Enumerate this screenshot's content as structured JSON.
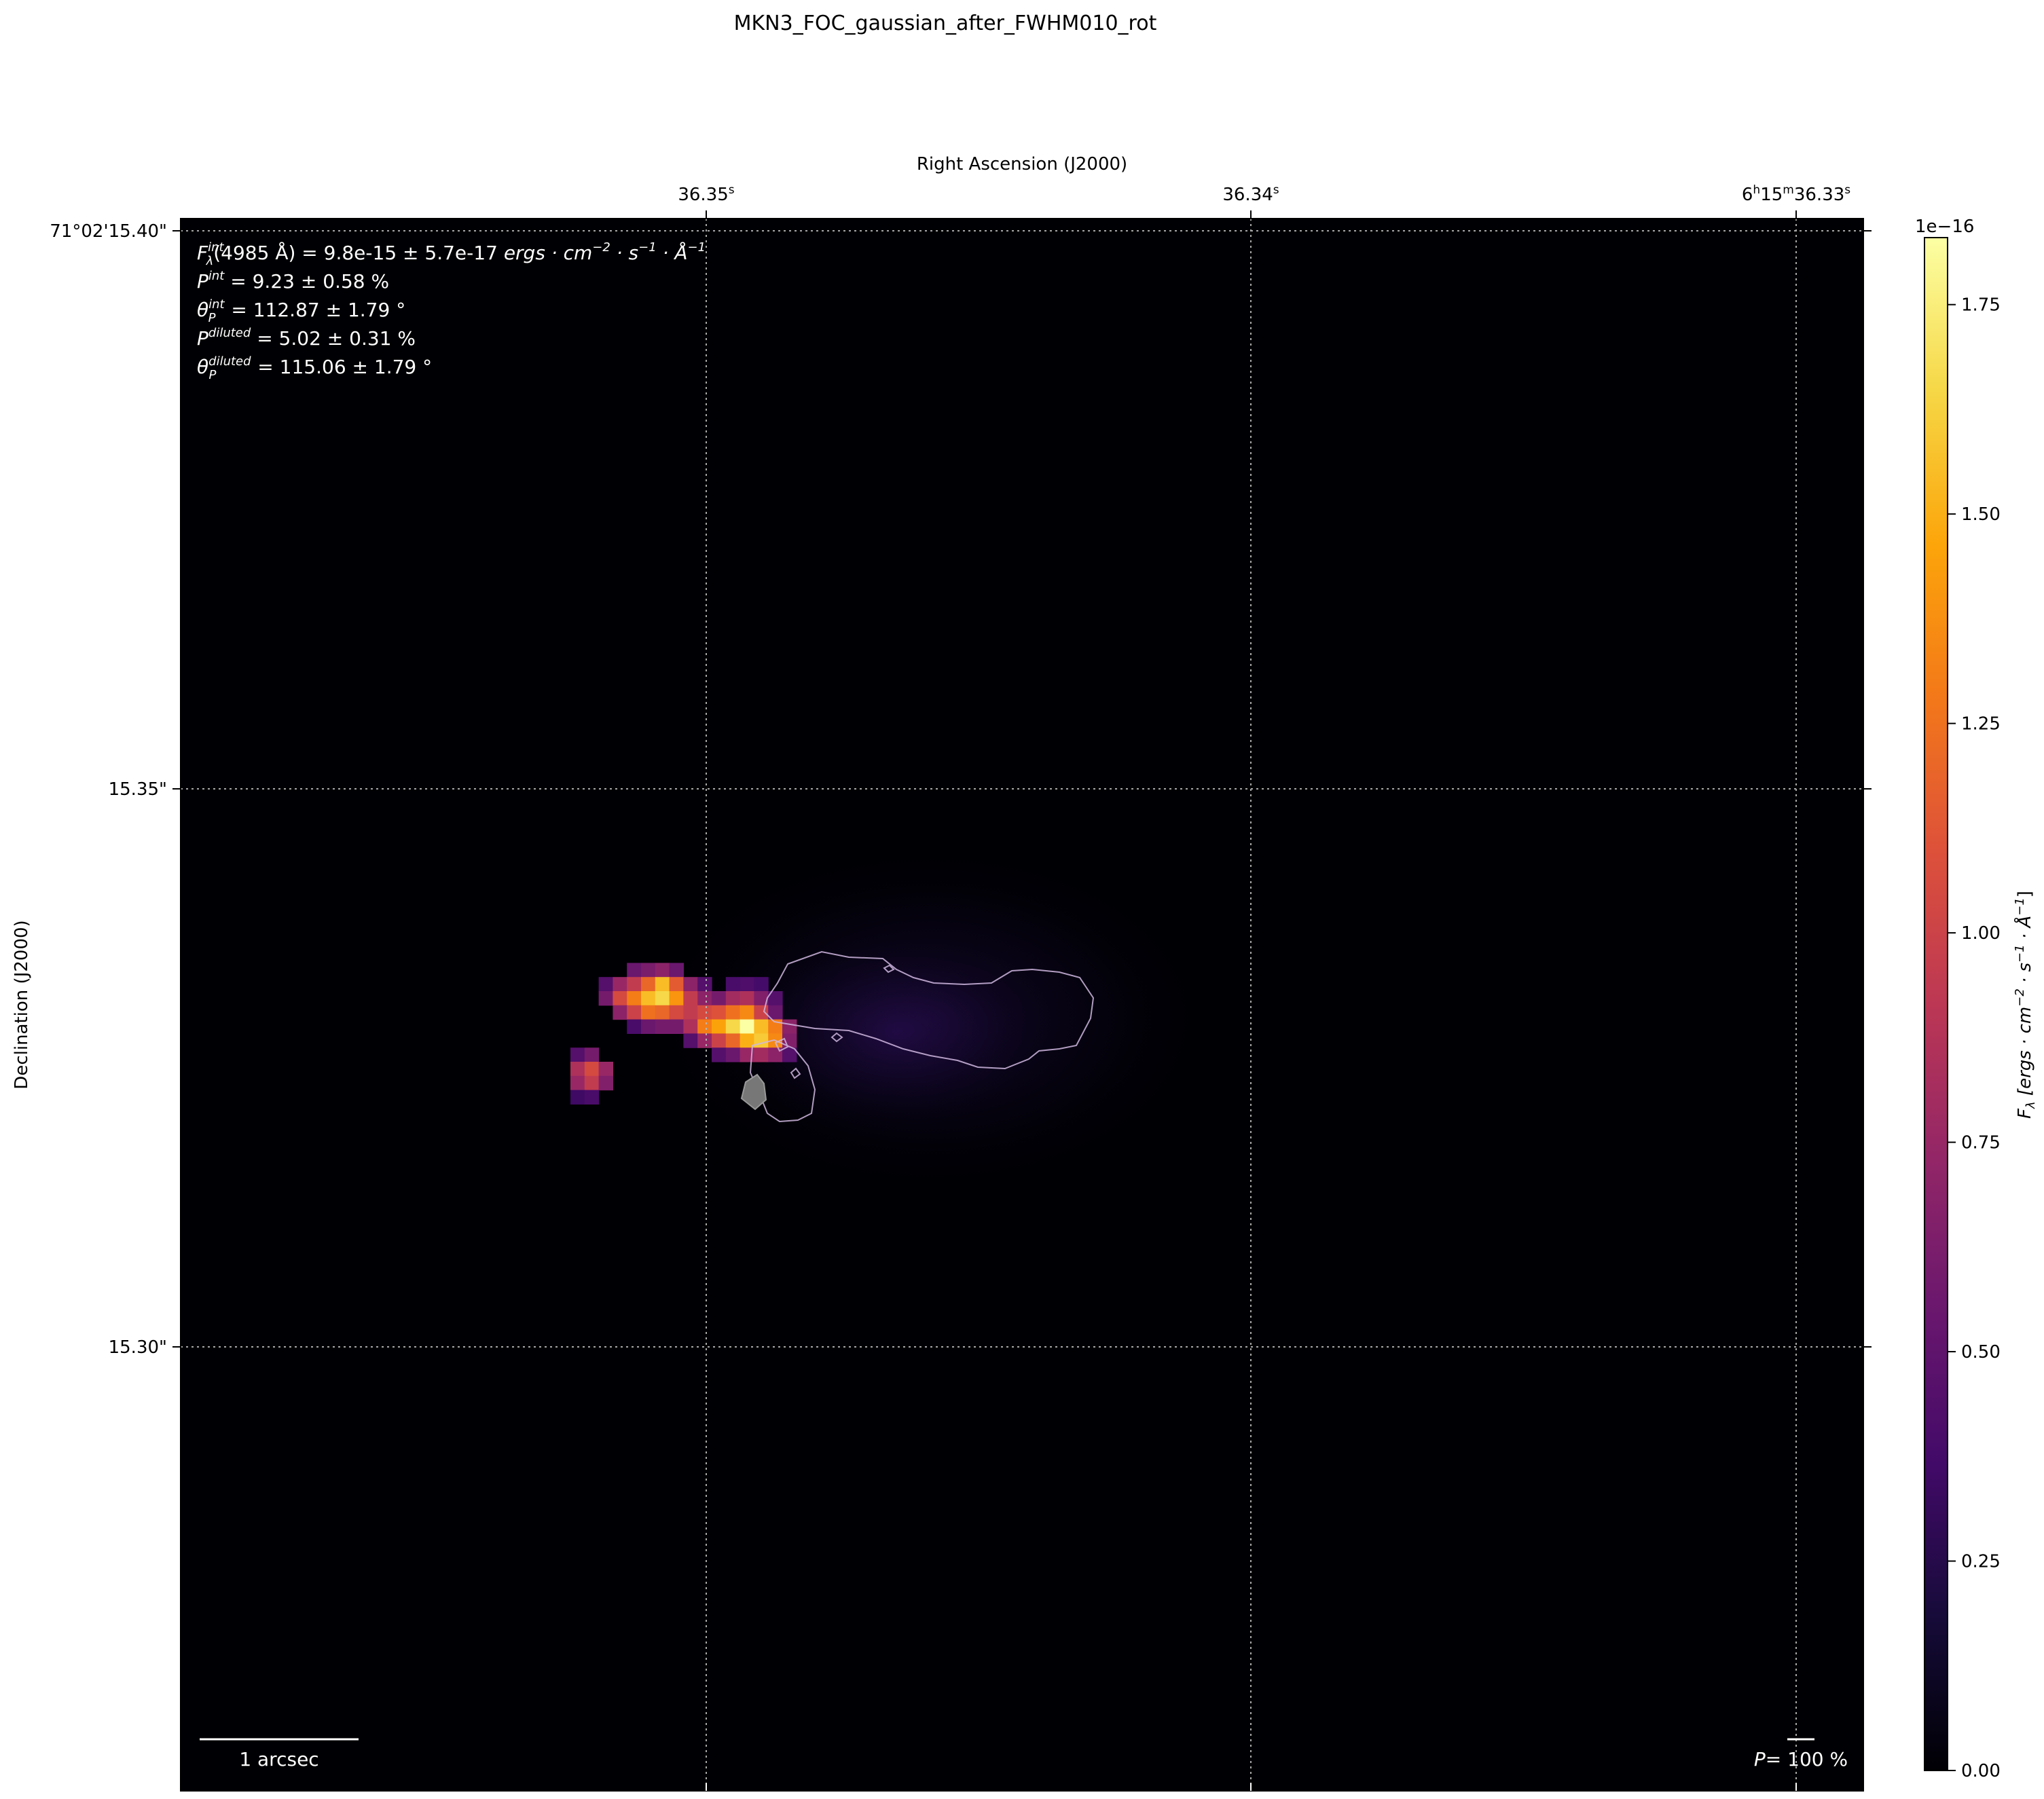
{
  "figure": {
    "title": "MKN3_FOC_gaussian_after_FWHM010_rot"
  },
  "chart_data": {
    "type": "heatmap",
    "title": "MKN3_FOC_gaussian_after_FWHM010_rot",
    "xlabel": "Right Ascension (J2000)",
    "ylabel": "Declination (J2000)",
    "colormap": "inferno",
    "grid": true,
    "x_ticks": [
      {
        "label_main": "36.35",
        "label_sup": "s",
        "ra_sec": 36.35
      },
      {
        "label_main": "36.34",
        "label_sup": "s",
        "ra_sec": 36.34
      },
      {
        "label_main": "6h15m36.33",
        "label_sup": "s",
        "ra_sec": 36.33
      }
    ],
    "x_tick_parts": {
      "last_h": "6",
      "last_h_sup": "h",
      "last_m": "15",
      "last_m_sup": "m",
      "last_s": "36.33",
      "last_s_sup": "s"
    },
    "y_ticks": [
      {
        "label": "71°02'15.40\"",
        "dec_arcsec": 15.4
      },
      {
        "label": "15.35\"",
        "dec_arcsec": 15.35
      },
      {
        "label": "15.30\"",
        "dec_arcsec": 15.3
      }
    ],
    "colorbar": {
      "label": "F_λ [ergs · cm⁻² · s⁻¹ · Å⁻¹]",
      "label_parts": {
        "f": "F",
        "sub": "λ",
        "units": "[ergs · cm",
        "e1": "−2",
        "mid1": " · s",
        "e2": "−1",
        "mid2": " · Å",
        "e3": "−1",
        "close": "]"
      },
      "offset_text": "1e−16",
      "min": 0.0,
      "max": 1.83,
      "ticks": [
        0.0,
        0.25,
        0.5,
        0.75,
        1.0,
        1.25,
        1.5,
        1.75
      ],
      "tick_labels": [
        "0.00",
        "0.25",
        "0.50",
        "0.75",
        "1.00",
        "1.25",
        "1.50",
        "1.75"
      ]
    },
    "annotations": {
      "line1": {
        "sym": "F",
        "sub": "λ",
        "sup": "int",
        "text": "(4985 Å) = 9.8e-15 ± 5.7e-17",
        "units": "ergs · cm",
        "u_e1": "−2",
        "u_mid": " · s",
        "u_e2": "−1",
        "u_mid2": " · Å",
        "u_e3": "−1"
      },
      "line2": {
        "sym": "P",
        "sup": "int",
        "text": " = 9.23 ± 0.58 %"
      },
      "line3": {
        "sym": "θ",
        "sub": "P",
        "sup": "int",
        "text": " = 112.87 ± 1.79 °"
      },
      "line4": {
        "sym": "P",
        "sup": "diluted",
        "text": " = 5.02 ± 0.31 %"
      },
      "line5": {
        "sym": "θ",
        "sub": "P",
        "sup": "diluted",
        "text": " = 115.06 ± 1.79 °"
      }
    },
    "integrated": {
      "wavelength_angstrom": 4985,
      "flux": "9.8e-15",
      "flux_err": "5.7e-17",
      "P_int_percent": 9.23,
      "P_int_err": 0.58,
      "theta_int_deg": 112.87,
      "theta_int_err": 1.79,
      "P_diluted_percent": 5.02,
      "P_diluted_err": 0.31,
      "theta_diluted_deg": 115.06,
      "theta_diluted_err": 1.79
    },
    "scalebar_label": "1 arcsec",
    "pol_scale_label": "= 100 %",
    "pol_scale_sym": "P",
    "bright_cells": [
      {
        "col": 22,
        "row": 28,
        "v": 0.55
      },
      {
        "col": 23,
        "row": 28,
        "v": 0.62
      },
      {
        "col": 24,
        "row": 28,
        "v": 0.7
      },
      {
        "col": 25,
        "row": 28,
        "v": 0.55
      },
      {
        "col": 20,
        "row": 29,
        "v": 0.45
      },
      {
        "col": 21,
        "row": 29,
        "v": 0.75
      },
      {
        "col": 22,
        "row": 29,
        "v": 0.95
      },
      {
        "col": 23,
        "row": 29,
        "v": 1.2
      },
      {
        "col": 24,
        "row": 29,
        "v": 1.55
      },
      {
        "col": 25,
        "row": 29,
        "v": 1.15
      },
      {
        "col": 26,
        "row": 29,
        "v": 0.7
      },
      {
        "col": 27,
        "row": 29,
        "v": 0.45
      },
      {
        "col": 29,
        "row": 29,
        "v": 0.4
      },
      {
        "col": 30,
        "row": 29,
        "v": 0.42
      },
      {
        "col": 31,
        "row": 29,
        "v": 0.38
      },
      {
        "col": 20,
        "row": 30,
        "v": 0.6
      },
      {
        "col": 21,
        "row": 30,
        "v": 1.05
      },
      {
        "col": 22,
        "row": 30,
        "v": 1.3
      },
      {
        "col": 23,
        "row": 30,
        "v": 1.55
      },
      {
        "col": 24,
        "row": 30,
        "v": 1.65
      },
      {
        "col": 25,
        "row": 30,
        "v": 1.4
      },
      {
        "col": 26,
        "row": 30,
        "v": 0.95
      },
      {
        "col": 27,
        "row": 30,
        "v": 0.7
      },
      {
        "col": 28,
        "row": 30,
        "v": 0.6
      },
      {
        "col": 29,
        "row": 30,
        "v": 0.8
      },
      {
        "col": 30,
        "row": 30,
        "v": 0.85
      },
      {
        "col": 31,
        "row": 30,
        "v": 0.65
      },
      {
        "col": 32,
        "row": 30,
        "v": 0.45
      },
      {
        "col": 21,
        "row": 31,
        "v": 0.7
      },
      {
        "col": 22,
        "row": 31,
        "v": 1.0
      },
      {
        "col": 23,
        "row": 31,
        "v": 1.25
      },
      {
        "col": 24,
        "row": 31,
        "v": 1.2
      },
      {
        "col": 25,
        "row": 31,
        "v": 1.05
      },
      {
        "col": 26,
        "row": 31,
        "v": 0.95
      },
      {
        "col": 27,
        "row": 31,
        "v": 1.05
      },
      {
        "col": 28,
        "row": 31,
        "v": 1.1
      },
      {
        "col": 29,
        "row": 31,
        "v": 1.25
      },
      {
        "col": 30,
        "row": 31,
        "v": 1.35
      },
      {
        "col": 31,
        "row": 31,
        "v": 1.0
      },
      {
        "col": 32,
        "row": 31,
        "v": 0.55
      },
      {
        "col": 22,
        "row": 32,
        "v": 0.4
      },
      {
        "col": 23,
        "row": 32,
        "v": 0.55
      },
      {
        "col": 24,
        "row": 32,
        "v": 0.6
      },
      {
        "col": 25,
        "row": 32,
        "v": 0.6
      },
      {
        "col": 26,
        "row": 32,
        "v": 0.85
      },
      {
        "col": 27,
        "row": 32,
        "v": 1.3
      },
      {
        "col": 28,
        "row": 32,
        "v": 1.45
      },
      {
        "col": 29,
        "row": 32,
        "v": 1.65
      },
      {
        "col": 30,
        "row": 32,
        "v": 1.83
      },
      {
        "col": 31,
        "row": 32,
        "v": 1.55
      },
      {
        "col": 32,
        "row": 32,
        "v": 1.3
      },
      {
        "col": 33,
        "row": 32,
        "v": 0.7
      },
      {
        "col": 26,
        "row": 33,
        "v": 0.45
      },
      {
        "col": 27,
        "row": 33,
        "v": 0.75
      },
      {
        "col": 28,
        "row": 33,
        "v": 1.0
      },
      {
        "col": 29,
        "row": 33,
        "v": 1.2
      },
      {
        "col": 30,
        "row": 33,
        "v": 1.5
      },
      {
        "col": 31,
        "row": 33,
        "v": 1.6
      },
      {
        "col": 32,
        "row": 33,
        "v": 1.35
      },
      {
        "col": 33,
        "row": 33,
        "v": 0.65
      },
      {
        "col": 28,
        "row": 34,
        "v": 0.45
      },
      {
        "col": 29,
        "row": 34,
        "v": 0.55
      },
      {
        "col": 30,
        "row": 34,
        "v": 0.75
      },
      {
        "col": 31,
        "row": 34,
        "v": 0.8
      },
      {
        "col": 32,
        "row": 34,
        "v": 0.7
      },
      {
        "col": 33,
        "row": 34,
        "v": 0.45
      },
      {
        "col": 18,
        "row": 34,
        "v": 0.45
      },
      {
        "col": 19,
        "row": 34,
        "v": 0.6
      },
      {
        "col": 18,
        "row": 35,
        "v": 0.85
      },
      {
        "col": 19,
        "row": 35,
        "v": 1.05
      },
      {
        "col": 20,
        "row": 35,
        "v": 0.75
      },
      {
        "col": 18,
        "row": 36,
        "v": 0.75
      },
      {
        "col": 19,
        "row": 36,
        "v": 0.95
      },
      {
        "col": 20,
        "row": 36,
        "v": 0.65
      },
      {
        "col": 18,
        "row": 37,
        "v": 0.35
      },
      {
        "col": 19,
        "row": 37,
        "v": 0.4
      }
    ]
  }
}
